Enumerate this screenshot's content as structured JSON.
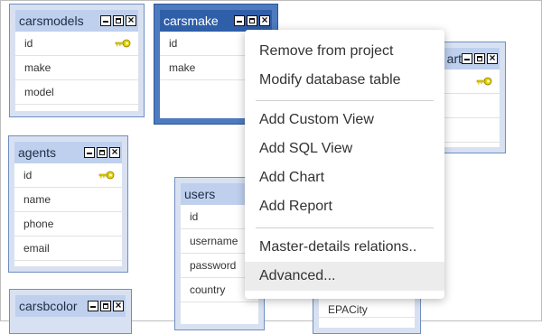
{
  "tables": {
    "carsmodels": {
      "title": "carsmodels",
      "fields": [
        "id",
        "make",
        "model"
      ]
    },
    "carsmake": {
      "title": "carsmake",
      "fields": [
        "id",
        "make"
      ]
    },
    "partial": {
      "title": "art"
    },
    "agents": {
      "title": "agents",
      "fields": [
        "id",
        "name",
        "phone",
        "email"
      ]
    },
    "users": {
      "title": "users",
      "fields": [
        "id",
        "username",
        "password",
        "country"
      ]
    },
    "carsbcolor": {
      "title": "carsbcolor"
    },
    "bottom": {
      "field": "EPACity"
    }
  },
  "context_menu": {
    "items": [
      "Remove from project",
      "Modify database table",
      "Add Custom View",
      "Add SQL View",
      "Add Chart",
      "Add Report",
      "Master-details relations..",
      "Advanced..."
    ],
    "hovered_index": 7
  },
  "colors": {
    "key": "#e8d300",
    "selected_header": "#2f5fa8",
    "header": "#bfd0ee"
  }
}
